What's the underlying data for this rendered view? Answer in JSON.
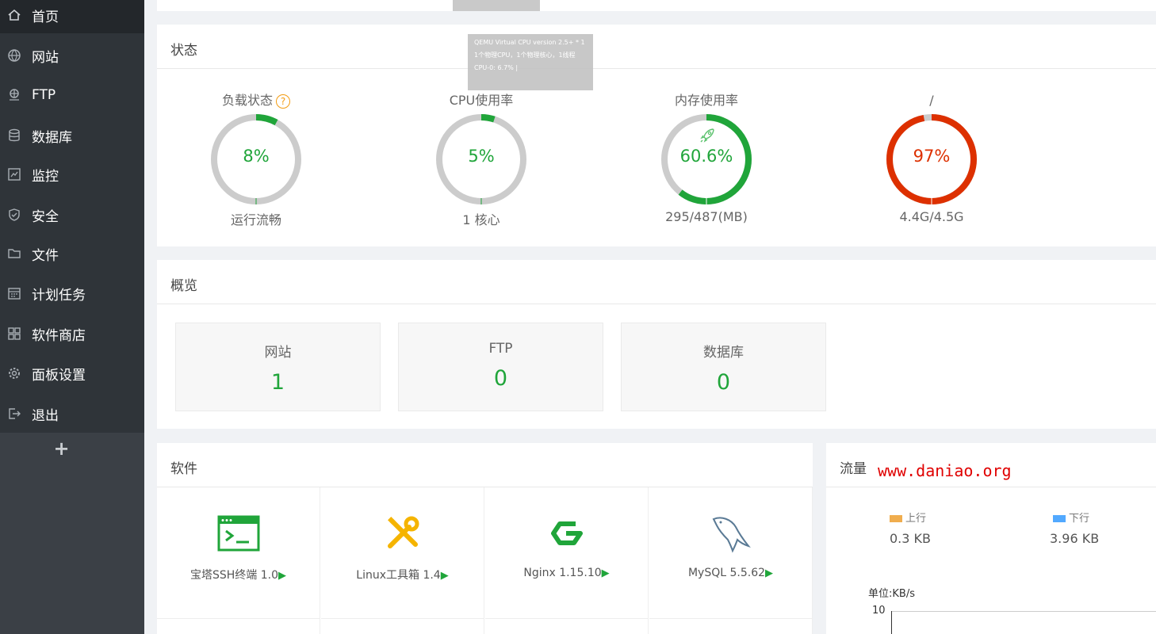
{
  "sidebar": {
    "items": [
      {
        "label": "首页",
        "icon": "home-icon"
      },
      {
        "label": "网站",
        "icon": "globe-icon"
      },
      {
        "label": "FTP",
        "icon": "ftp-icon"
      },
      {
        "label": "数据库",
        "icon": "database-icon"
      },
      {
        "label": "监控",
        "icon": "monitor-icon"
      },
      {
        "label": "安全",
        "icon": "shield-icon"
      },
      {
        "label": "文件",
        "icon": "folder-icon"
      },
      {
        "label": "计划任务",
        "icon": "calendar-icon"
      },
      {
        "label": "软件商店",
        "icon": "apps-icon"
      },
      {
        "label": "面板设置",
        "icon": "gear-icon"
      },
      {
        "label": "退出",
        "icon": "logout-icon"
      }
    ],
    "add": "+"
  },
  "status": {
    "title": "状态",
    "help": "?",
    "gauges": [
      {
        "label": "负载状态",
        "value": "8%",
        "percent": 8,
        "sub": "运行流畅",
        "color": "#20a53a"
      },
      {
        "label": "CPU使用率",
        "value": "5%",
        "percent": 5,
        "sub": "1 核心",
        "color": "#20a53a"
      },
      {
        "label": "内存使用率",
        "value": "60.6%",
        "percent": 60.6,
        "sub": "295/487(MB)",
        "color": "#20a53a"
      },
      {
        "label": "/",
        "value": "97%",
        "percent": 97,
        "sub": "4.4G/4.5G",
        "color": "#dd3000"
      }
    ],
    "tooltip": {
      "line1": "QEMU Virtual CPU version 2.5+ * 1",
      "line2": "1个物理CPU，1个物理核心，1线程",
      "line3": "CPU-0: 6.7% |"
    }
  },
  "overview": {
    "title": "概览",
    "cards": [
      {
        "label": "网站",
        "value": "1"
      },
      {
        "label": "FTP",
        "value": "0"
      },
      {
        "label": "数据库",
        "value": "0"
      }
    ]
  },
  "software": {
    "title": "软件",
    "items": [
      {
        "name": "宝塔SSH终端 1.0",
        "icon": "terminal-icon"
      },
      {
        "name": "Linux工具箱 1.4",
        "icon": "tools-icon"
      },
      {
        "name": "Nginx 1.15.10",
        "icon": "nginx-icon"
      },
      {
        "name": "MySQL 5.5.62",
        "icon": "mysql-icon"
      }
    ],
    "arrow": "▶"
  },
  "traffic": {
    "title": "流量",
    "watermark": "www.daniao.org",
    "up_label": "上行",
    "up_value": "0.3 KB",
    "down_label": "下行",
    "down_value": "3.96 KB",
    "unit": "单位:KB/s",
    "y_tick": "10",
    "up_color": "#f0ad4e",
    "down_color": "#52a9ff"
  }
}
